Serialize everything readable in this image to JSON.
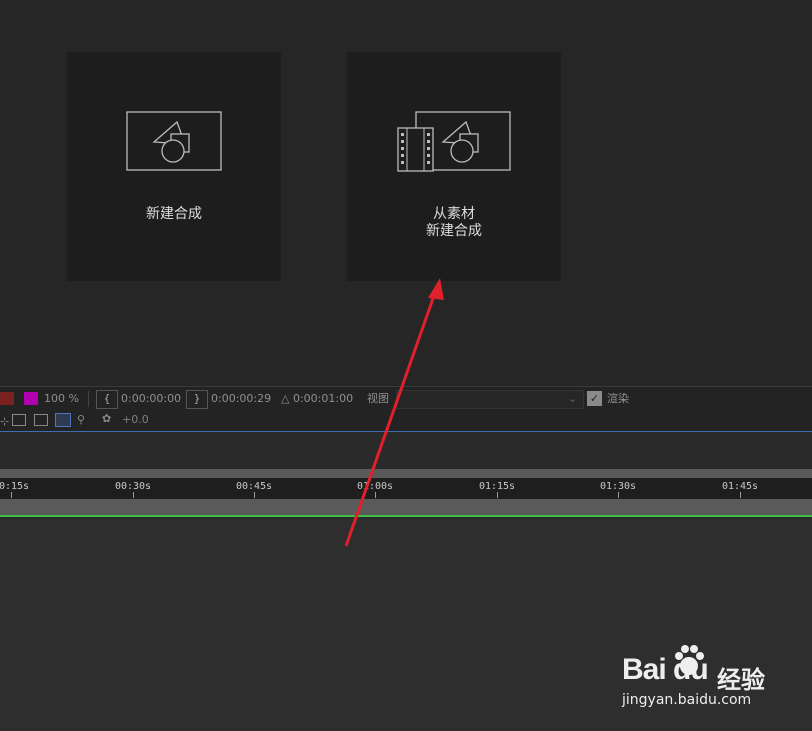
{
  "cards": {
    "new_comp": {
      "label": "新建合成"
    },
    "from_footage": {
      "line1": "从素材",
      "line2": "新建合成"
    }
  },
  "toolbar": {
    "zoom": "100 %",
    "time_start": "0:00:00:00",
    "time_end": "0:00:00:29",
    "duration": "△ 0:00:01:00",
    "view_label": "视图",
    "render_label": "渲染",
    "exposure": "+0.0"
  },
  "timeline": {
    "ticks": [
      "0:15s",
      "00:30s",
      "00:45s",
      "01:00s",
      "01:15s",
      "01:30s",
      "01:45s"
    ]
  },
  "watermark": {
    "baidu": "Bai du",
    "jingyan": "经验",
    "url": "jingyan.baidu.com"
  },
  "colors": {
    "accent_purple": "#b000b0",
    "timeline_green": "#3fbf3f",
    "arrow_red": "#e0202a"
  }
}
